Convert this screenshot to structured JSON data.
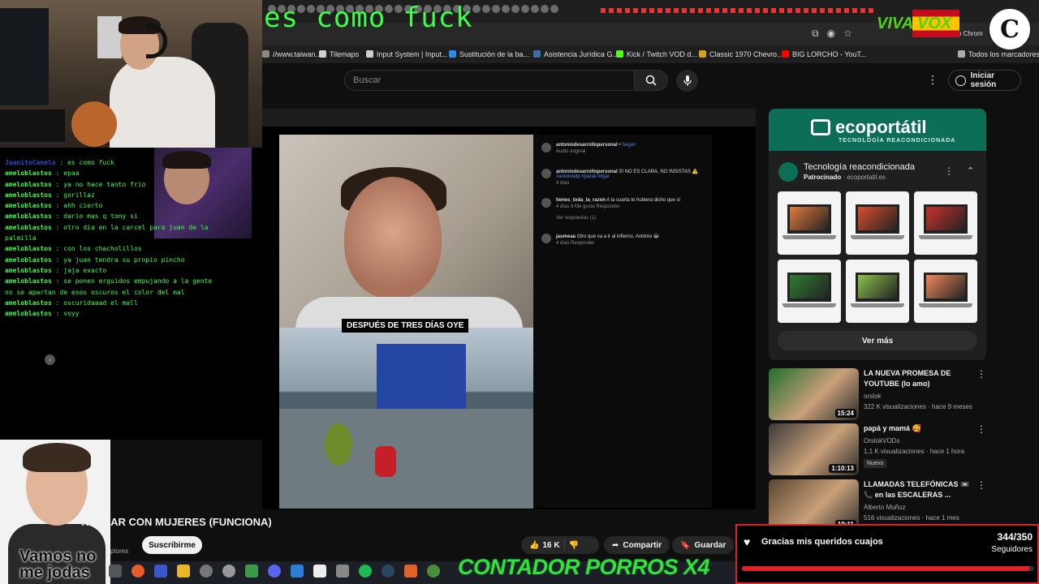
{
  "overlay_title": "es como fuck",
  "browser": {
    "profile_text": "o Chrom",
    "bookmarks": [
      {
        "label": "//www.taiwan...",
        "color": "#888888"
      },
      {
        "label": "Tilemaps",
        "color": "#cfcfcf"
      },
      {
        "label": "Input System | Input...",
        "color": "#cfcfcf"
      },
      {
        "label": "Sustitución de la ba...",
        "color": "#2d8cf0"
      },
      {
        "label": "Asistencia Jurídica G...",
        "color": "#3a6ea5"
      },
      {
        "label": "Kick / Twitch VOD d...",
        "color": "#53fc18"
      },
      {
        "label": "Classic 1970 Chevro...",
        "color": "#d4a017"
      },
      {
        "label": "BIG LORCHO - YouT...",
        "color": "#ff0000"
      }
    ],
    "bookmarks_all": "Todos los marcadores"
  },
  "overlay_logo": {
    "text": "VIVA VOX"
  },
  "youtube": {
    "search_placeholder": "Buscar",
    "signin_label": "Iniciar sesión",
    "video_title": "HABLAR CON MUJERES (FUNCIONA)",
    "channel_fragment": "ptores",
    "subscribe_label": "Suscribirme",
    "likes": "16 K",
    "share_label": "Compartir",
    "save_label": "Guardar"
  },
  "video": {
    "caption": "DESPUÉS DE TRES DÍAS OYE",
    "ig": {
      "author": "antoniodesarrollopersonal",
      "follow": "Seguir",
      "audio": "Audio original",
      "post_text": "SI NO ES CLARA, NO INSISTAS ⚠️",
      "tags": "#antoniodp #parati #ligar",
      "post_time": "4 días",
      "c1_user": "tienes_toda_la_razon",
      "c1_text": "A la cuarta te hubiera dicho que sí",
      "c1_meta": "4 días   8 Me gusta   Responder",
      "c1_replies": "Ver respuestas (1)",
      "c2_user": "jaumeaa",
      "c2_text": "Otro que va a ir al infierno, António 😂",
      "c2_meta": "4 días   Responder"
    }
  },
  "chat": {
    "messages": [
      {
        "user": "JuanitoCanelo",
        "text": "es como fuck"
      },
      {
        "user": "ameloblastos",
        "text": "epaa"
      },
      {
        "user": "ameloblastos",
        "text": "ya no hace tanto frio"
      },
      {
        "user": "ameloblastos",
        "text": "gorillaz"
      },
      {
        "user": "ameloblastos",
        "text": "ahh cierto"
      },
      {
        "user": "ameloblastos",
        "text": "dario mas q tony si"
      },
      {
        "user": "ameloblastos",
        "text": "otro dia en la carcel para juan de la palmilla"
      },
      {
        "user": "ameloblastos",
        "text": "con los chacholillos"
      },
      {
        "user": "ameloblastos",
        "text": "ya juan tendra su propio pincho"
      },
      {
        "user": "ameloblastos",
        "text": "jaja exacto"
      },
      {
        "user": "ameloblastos",
        "text": "se ponen erguidos empujando a la gente no se apartan de esos oscuros el color del mal"
      },
      {
        "user": "ameloblastos",
        "text": "oscuridaaad el mall"
      },
      {
        "user": "ameloblastos",
        "text": "voyy"
      }
    ],
    "webcam_overlay_text": "Vamos no me jodas"
  },
  "sidebar": {
    "ad": {
      "brand": "ecoportátil",
      "tagline": "TECNOLOGÍA REACONDICIONADA",
      "title": "Tecnología reacondicionada",
      "sponsored": "Patrocinado",
      "domain": "ecoportatil.es",
      "more_label": "Ver más",
      "products": [
        {
          "screen": "#e07a3a"
        },
        {
          "screen": "#d94f2b"
        },
        {
          "screen": "#c8322a"
        },
        {
          "screen": "#2e7d32"
        },
        {
          "screen": "#8bc34a"
        },
        {
          "screen": "#ef8a5a"
        }
      ]
    },
    "recommendations": [
      {
        "title": "LA NUEVA PROMESA DE YOUTUBE (lo amo)",
        "channel": "orslok",
        "meta": "322 K visualizaciones · hace 9 meses",
        "duration": "15:24",
        "badge": "",
        "thumb": "#1f6e2e"
      },
      {
        "title": "papá y mamá 🥰",
        "channel": "OrslokVODs",
        "meta": "1,1 K visualizaciones · hace 1 hora",
        "duration": "1:10:13",
        "badge": "Nuevo",
        "thumb": "#3a3a3a"
      },
      {
        "title": "LLAMADAS TELEFÓNICAS 📼📞 en las ESCALERAS ...",
        "channel": "Alberto Muñoz",
        "meta": "516 visualizaciones · hace 1 mes",
        "duration": "10:11",
        "badge": "",
        "thumb": "#5a4630"
      }
    ]
  },
  "goal": {
    "message": "Gracias mis queridos cuajos",
    "current": 344,
    "target": 350,
    "count_text": "344/350",
    "label": "Seguidores",
    "progress_fraction": 0.983
  },
  "counter_text": "CONTADOR PORROS X4"
}
